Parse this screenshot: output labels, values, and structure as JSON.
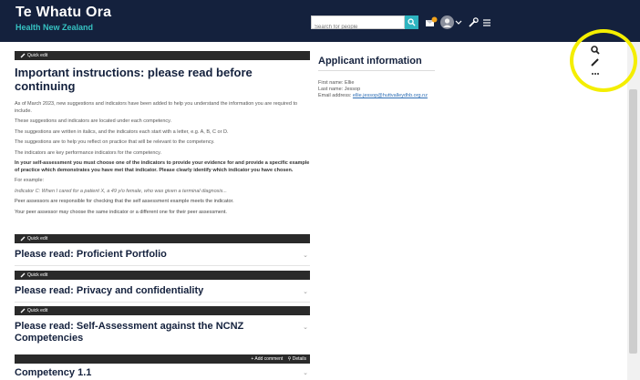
{
  "header": {
    "brand_title": "Te Whatu Ora",
    "brand_subtitle": "Health New Zealand",
    "search_placeholder": "Search for people"
  },
  "colors": {
    "header_bg": "#14213d",
    "accent": "#2eb4c0",
    "highlight": "#f4ee00"
  },
  "quick_edit_label": "Quick edit",
  "instructions": {
    "heading": "Important instructions: please read before continuing",
    "paragraphs": [
      "As of March 2023, new suggestions and indicators have been added to help you understand the information you are required to include.",
      "These suggestions and indicators are located under each competency.",
      "The suggestions are written in italics, and the indicators each start with a letter, e.g. A, B, C or D.",
      "The suggestions are to help you reflect on practice that will be relevant to the competency.",
      "The indicators are key performance indicators for the competency.",
      "In your self-assessment you must choose one of the indicators to provide your evidence for and provide a specific example of practice which demonstrates you have met that indicator. Please clearly identify which indicator you have chosen.",
      "For example:",
      "Indicator C: When I cared for a patient X, a 49 y/o female, who was given a terminal diagnosis...",
      "Peer assessors are responsible for checking that the self assessment example meets the indicator.",
      "Your peer assessor may choose the same indicator or a different one for their peer assessment."
    ]
  },
  "accordions": [
    {
      "title": "Please read: Proficient Portfolio"
    },
    {
      "title": "Please read: Privacy and confidentiality"
    },
    {
      "title": "Please read: Self-Assessment against the NCNZ Competencies"
    }
  ],
  "competency": {
    "add_comment_label": "+ Add comment",
    "details_label": "Details",
    "title": "Competency 1.1"
  },
  "applicant": {
    "heading": "Applicant information",
    "first_name_line": "First name: Ellie",
    "last_name_line": "Last name: Jessop",
    "email_label": "Email address:",
    "email_value": "ellie.jessop@huttvalleydhb.org.nz"
  },
  "icons": {
    "search": "magnifier-icon",
    "notifications": "notifications-icon",
    "avatar": "user-avatar",
    "tools": "wrench-icon",
    "menu": "hamburger-icon",
    "sidebar": [
      "search-icon",
      "pencil-icon",
      "more-icon"
    ]
  }
}
